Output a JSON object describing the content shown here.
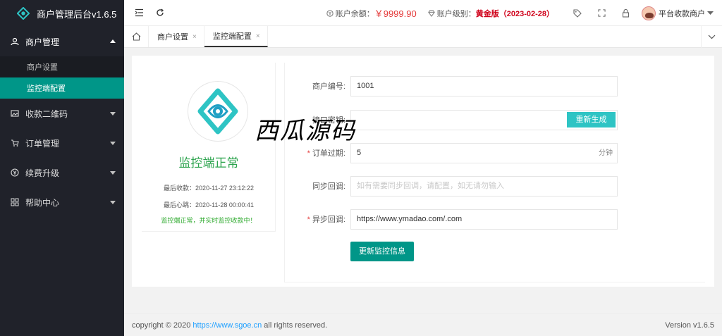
{
  "app": {
    "title": "商户管理后台v1.6.5"
  },
  "sidebar": {
    "groups": [
      {
        "label": "商户管理",
        "expanded": true,
        "items": [
          {
            "label": "商户设置"
          },
          {
            "label": "监控端配置",
            "active": true
          }
        ]
      },
      {
        "label": "收款二维码"
      },
      {
        "label": "订单管理"
      },
      {
        "label": "续费升级"
      },
      {
        "label": "帮助中心"
      }
    ]
  },
  "header": {
    "balance_label": "账户余额：",
    "balance_value": "￥9999.90",
    "level_label": "账户级别：",
    "level_value": "黄金版（2023-02-28）",
    "user_name": "平台收款商户"
  },
  "tabs": [
    {
      "label": "商户设置",
      "close": "×"
    },
    {
      "label": "监控端配置",
      "close": "×",
      "active": true
    }
  ],
  "status": {
    "title": "监控端正常",
    "last_payment": "最后收款：2020-11-27 23:12:22",
    "last_heartbeat": "最后心跳：2020-11-28 00:00:41",
    "message": "监控端正常，并实时监控收款中！"
  },
  "form": {
    "merchant_no_label": "商户编号:",
    "merchant_no_value": "1001",
    "secret_label": "接口密钥:",
    "secret_value": "",
    "regen_button": "重新生成",
    "expire_label": "订单过期:",
    "expire_value": "5",
    "expire_suffix": "分钟",
    "sync_label": "同步回调:",
    "sync_placeholder": "如有需要同步回调，请配置，如无请勿输入",
    "async_label": "异步回调:",
    "async_value": "https://www.ymadao.com/.com",
    "update_button": "更新监控信息",
    "required_mark": "*"
  },
  "watermark": "西瓜源码",
  "footer": {
    "copyright_prefix": "copyright © 2020",
    "link": "https://www.sgoe.cn",
    "copyright_suffix": "all rights reserved.",
    "version": "Version v1.6.5"
  },
  "colors": {
    "primary": "#009688",
    "sidebar": "#20222a",
    "accent_cyan": "#2ec4c4",
    "status_green": "#2da44e",
    "money_red": "#e43a3a"
  }
}
